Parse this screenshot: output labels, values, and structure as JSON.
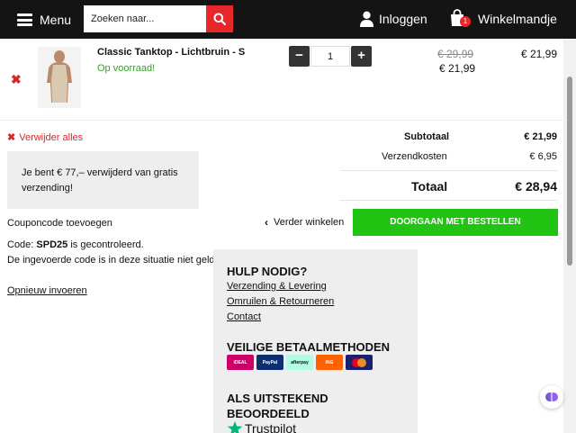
{
  "header": {
    "menu_label": "Menu",
    "search_placeholder": "Zoeken naar...",
    "login_label": "Inloggen",
    "cart_label": "Winkelmandje",
    "cart_count": "1"
  },
  "cart_item": {
    "name": "Classic Tanktop - Lichtbruin - S",
    "stock": "Op voorraad!",
    "quantity": "1",
    "qty_minus": "−",
    "qty_plus": "+",
    "price_old": "€ 29,99",
    "price_new": "€ 21,99",
    "line_total": "€ 21,99"
  },
  "cart_actions": {
    "remove_all": "Verwijder alles",
    "continue_shopping": "Verder winkelen",
    "checkout": "DOORGAAN MET BESTELLEN"
  },
  "shipping_notice": {
    "line1": "Je bent € 77,– verwijderd van gratis",
    "line2": "verzending!"
  },
  "coupon": {
    "title": "Couponcode toevoegen",
    "status_prefix": "Code: ",
    "code": "SPD25",
    "status_suffix": " is gecontroleerd.",
    "message": "De ingevoerde code is in deze situatie niet geldig.",
    "reenter": "Opnieuw invoeren"
  },
  "totals": {
    "subtotal_label": "Subtotaal",
    "subtotal_value": "€ 21,99",
    "shipping_label": "Verzendkosten",
    "shipping_value": "€ 6,95",
    "total_label": "Totaal",
    "total_value": "€ 28,94"
  },
  "help": {
    "title": "HULP NODIG?",
    "links": [
      "Verzending & Levering",
      "Omruilen & Retourneren",
      "Contact"
    ],
    "payment_title": "VEILIGE BETAALMETHODEN",
    "payment_methods": [
      "iDEAL",
      "PayPal",
      "afterpay",
      "ING",
      "mastercard"
    ],
    "rated_title": "ALS UITSTEKEND BEOORDEELD",
    "trustpilot": "Trustpilot"
  },
  "colors": {
    "header_bg": "#141414",
    "accent_red": "#e8272a",
    "checkout_green": "#22c414",
    "stock_green": "#33a02c",
    "trustpilot_green": "#00b67a"
  }
}
